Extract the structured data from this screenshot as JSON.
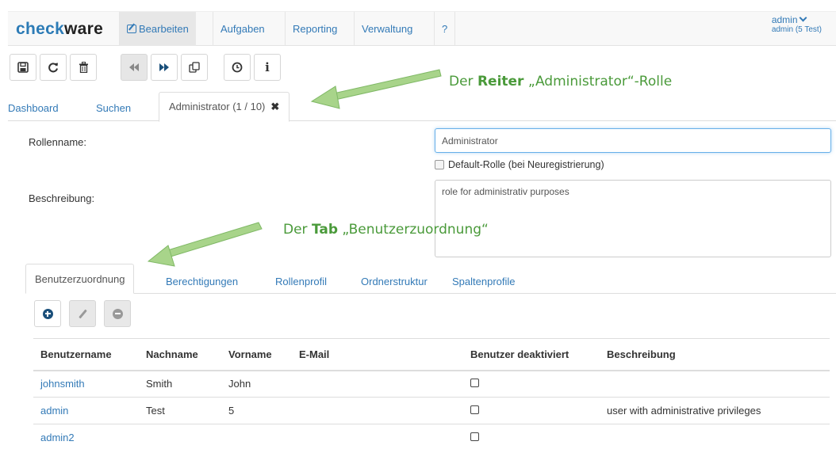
{
  "brand": {
    "part1": "check",
    "part2": "ware"
  },
  "nav": {
    "items": [
      "Bearbeiten",
      "Aufgaben",
      "Reporting",
      "Verwaltung",
      "?"
    ],
    "user": "admin",
    "user_sub": "admin (5 Test)"
  },
  "toolbar": {
    "icons": [
      "save-icon",
      "refresh-icon",
      "trash-icon",
      "rewind-icon",
      "fast-forward-icon",
      "copy-icon",
      "clock-icon",
      "info-icon"
    ],
    "info_label": "i"
  },
  "page_tabs": {
    "dashboard": "Dashboard",
    "search": "Suchen",
    "active": "Administrator (1 / 10)",
    "close": "✖"
  },
  "form": {
    "role_name_label": "Rollenname:",
    "role_name_value": "Administrator",
    "default_role_label": "Default-Rolle (bei Neuregistrierung)",
    "description_label": "Beschreibung:",
    "description_value": "role for administrativ purposes"
  },
  "inner_tabs": [
    "Benutzerzuordnung",
    "Berechtigungen",
    "Rollenprofil",
    "Ordnerstruktur",
    "Spaltenprofile"
  ],
  "table": {
    "headers": [
      "Benutzername",
      "Nachname",
      "Vorname",
      "E-Mail",
      "Benutzer deaktiviert",
      "Beschreibung"
    ],
    "rows": [
      {
        "username": "johnsmith",
        "lastname": "Smith",
        "firstname": "John",
        "email": "",
        "description": ""
      },
      {
        "username": "admin",
        "lastname": "Test",
        "firstname": "5",
        "email": "",
        "description": "user with administrative privileges"
      },
      {
        "username": "admin2",
        "lastname": "",
        "firstname": "",
        "email": "",
        "description": ""
      }
    ]
  },
  "annotations": {
    "reiter_pre": "Der ",
    "reiter_bold": "Reiter",
    "reiter_post": " „Administrator“-Rolle",
    "tab_pre": "Der ",
    "tab_bold": "Tab",
    "tab_post": " „Benutzerzuordnung“"
  },
  "colors": {
    "link": "#337ab7",
    "brand_blue": "#2c7bb6",
    "annotation_green": "#4a9a3a"
  }
}
